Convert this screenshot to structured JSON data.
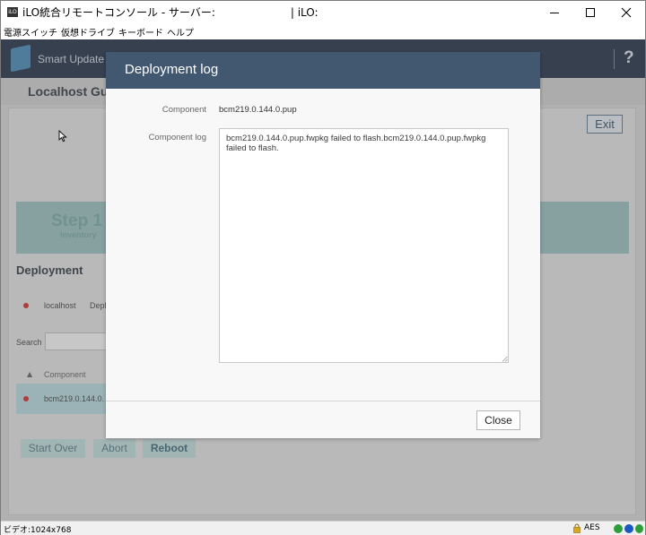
{
  "window": {
    "title": "iLO統合リモートコンソール - サーバー:                      | iLO:",
    "app_icon_text": "iLO",
    "menu": [
      "電源スイッチ",
      "仮想ドライブ",
      "キーボード",
      "ヘルプ"
    ]
  },
  "app": {
    "title": "Smart Update Ma",
    "help_label": "?",
    "localhost_title": "Localhost Gu",
    "exit_label": "Exit",
    "step_title": "Step 1",
    "step_subtitle": "Inventory",
    "deployment_heading": "Deployment",
    "node_name": "localhost",
    "node_status": "Depl",
    "search_label": "Search",
    "search_value": "",
    "component_column": "Component",
    "component_row": "bcm219.0.144.0.",
    "start_over_label": "Start Over",
    "abort_label": "Abort",
    "reboot_label": "Reboot"
  },
  "dialog": {
    "title": "Deployment log",
    "component_label": "Component",
    "component_value": "bcm219.0.144.0.pup",
    "log_label": "Component log",
    "log_text": "bcm219.0.144.0.pup.fwpkg failed to flash.bcm219.0.144.0.pup.fwpkg failed to flash.",
    "close_label": "Close"
  },
  "statusbar": {
    "video_text": "ビデオ:1024x768",
    "encryption": "AES"
  },
  "colors": {
    "dialog_header": "#425871",
    "status_red": "#c81e1e",
    "step_band": "#8fb7b7"
  }
}
